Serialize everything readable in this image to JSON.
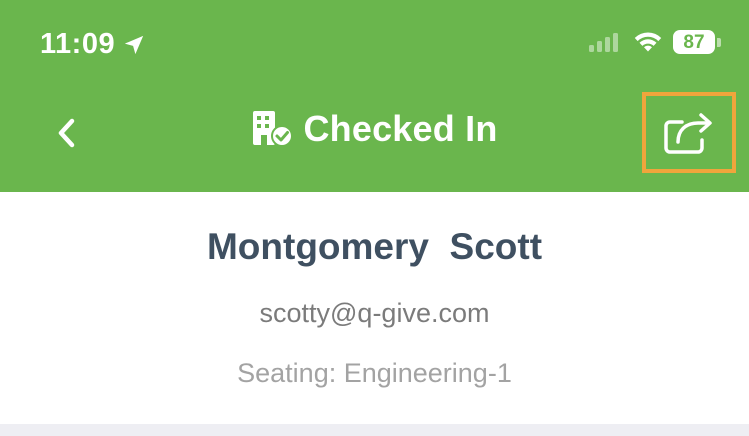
{
  "status_bar": {
    "time": "11:09",
    "location_icon": "location-arrow-icon",
    "signal_icon": "cellular-signal-icon",
    "wifi_icon": "wifi-icon",
    "battery_level": "87"
  },
  "nav": {
    "back_icon": "chevron-left-icon",
    "title_icon": "building-check-icon",
    "title": "Checked In",
    "share_icon": "share-icon"
  },
  "attendee": {
    "name": "Montgomery  Scott",
    "email": "scotty@q-give.com",
    "seating": "Seating: Engineering-1"
  },
  "colors": {
    "header_green": "#6ab64d",
    "highlight_orange": "#f0a53c",
    "name_text": "#3f5061"
  }
}
